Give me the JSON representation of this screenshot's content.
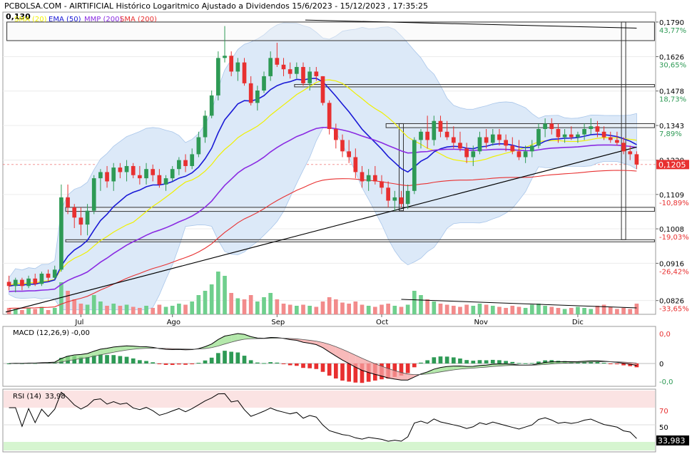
{
  "header": {
    "title": "PCBOLSA.COM - AIRTIFICIAL Histórico Logaritmico Ajustado a Dividendos 15/6/2023 - 15/12/2023 , 17:35:25",
    "price_marker": "0,130",
    "legend": [
      {
        "label": "SMA (20)",
        "color": "#f0f000"
      },
      {
        "label": "EMA (50)",
        "color": "#1a1ad6"
      },
      {
        "label": "MMP (200)",
        "color": "#8a2be2"
      },
      {
        "label": "SMA (200)",
        "color": "#e83030"
      }
    ]
  },
  "price_axis": {
    "ticks": [
      {
        "price": 0.179,
        "label": "0,1790",
        "pct": "43,77%"
      },
      {
        "price": 0.1626,
        "label": "0,1626",
        "pct": "30,65%"
      },
      {
        "price": 0.1478,
        "label": "0,1478",
        "pct": "18,73%"
      },
      {
        "price": 0.1343,
        "label": "0,1343",
        "pct": "7,89%"
      },
      {
        "price": 0.122,
        "label": "0,1220",
        "pct": ""
      },
      {
        "price": 0.1109,
        "label": "0,1109",
        "pct": "-10,89%"
      },
      {
        "price": 0.1008,
        "label": "0,1008",
        "pct": "-19,03%"
      },
      {
        "price": 0.0916,
        "label": "0,0916",
        "pct": "-26,42%"
      },
      {
        "price": 0.0826,
        "label": "0,0826",
        "pct": "-33,65%"
      }
    ],
    "current": {
      "price": 0.1205,
      "label": "0,1205"
    }
  },
  "months": [
    "Jul",
    "Ago",
    "Sep",
    "Oct",
    "Nov",
    "Dic"
  ],
  "macd": {
    "label": "MACD (12,26,9)",
    "value": "-0,00",
    "axis": [
      "0,0",
      "0",
      "-0,0"
    ]
  },
  "rsi": {
    "label": "RSI (14)",
    "value": "33,98",
    "current": "33,983",
    "axis": [
      "70",
      "50"
    ]
  },
  "colors": {
    "up": "#2e9a55",
    "down": "#e83030",
    "sma20": "#f0f000",
    "ema50": "#1a1ad6",
    "mmp200": "#8a2be2",
    "sma200": "#e83030",
    "band": "#dce9f8",
    "overbought": "#fbe3e3",
    "oversold": "#d6f5d0"
  },
  "chart_data": {
    "type": "candlestick",
    "title": "AIRTIFICIAL Histórico Logaritmico Ajustado a Dividendos 15/6/2023 - 15/12/2023",
    "y_scale": "log",
    "ylim": [
      0.0795,
      0.184
    ],
    "x_range": [
      "15/6/2023",
      "15/12/2023"
    ],
    "candles": [
      {
        "o": 0.087,
        "h": 0.0885,
        "l": 0.085,
        "c": 0.086
      },
      {
        "o": 0.086,
        "h": 0.088,
        "l": 0.0845,
        "c": 0.0875
      },
      {
        "o": 0.0875,
        "h": 0.088,
        "l": 0.085,
        "c": 0.086
      },
      {
        "o": 0.086,
        "h": 0.0885,
        "l": 0.0855,
        "c": 0.0878
      },
      {
        "o": 0.0878,
        "h": 0.089,
        "l": 0.086,
        "c": 0.0865
      },
      {
        "o": 0.0865,
        "h": 0.0895,
        "l": 0.086,
        "c": 0.089
      },
      {
        "o": 0.089,
        "h": 0.09,
        "l": 0.087,
        "c": 0.088
      },
      {
        "o": 0.088,
        "h": 0.091,
        "l": 0.0875,
        "c": 0.09
      },
      {
        "o": 0.09,
        "h": 0.114,
        "l": 0.0895,
        "c": 0.11
      },
      {
        "o": 0.11,
        "h": 0.114,
        "l": 0.105,
        "c": 0.107
      },
      {
        "o": 0.107,
        "h": 0.108,
        "l": 0.101,
        "c": 0.104
      },
      {
        "o": 0.104,
        "h": 0.107,
        "l": 0.099,
        "c": 0.102
      },
      {
        "o": 0.102,
        "h": 0.108,
        "l": 0.099,
        "c": 0.106
      },
      {
        "o": 0.106,
        "h": 0.117,
        "l": 0.105,
        "c": 0.116
      },
      {
        "o": 0.116,
        "h": 0.119,
        "l": 0.112,
        "c": 0.118
      },
      {
        "o": 0.118,
        "h": 0.12,
        "l": 0.113,
        "c": 0.115
      },
      {
        "o": 0.115,
        "h": 0.121,
        "l": 0.112,
        "c": 0.1195
      },
      {
        "o": 0.1195,
        "h": 0.121,
        "l": 0.116,
        "c": 0.118
      },
      {
        "o": 0.118,
        "h": 0.122,
        "l": 0.115,
        "c": 0.12
      },
      {
        "o": 0.12,
        "h": 0.121,
        "l": 0.116,
        "c": 0.117
      },
      {
        "o": 0.117,
        "h": 0.12,
        "l": 0.114,
        "c": 0.116
      },
      {
        "o": 0.116,
        "h": 0.121,
        "l": 0.114,
        "c": 0.119
      },
      {
        "o": 0.119,
        "h": 0.1205,
        "l": 0.115,
        "c": 0.117
      },
      {
        "o": 0.117,
        "h": 0.119,
        "l": 0.113,
        "c": 0.114
      },
      {
        "o": 0.114,
        "h": 0.117,
        "l": 0.112,
        "c": 0.116
      },
      {
        "o": 0.116,
        "h": 0.12,
        "l": 0.115,
        "c": 0.119
      },
      {
        "o": 0.119,
        "h": 0.123,
        "l": 0.117,
        "c": 0.122
      },
      {
        "o": 0.122,
        "h": 0.124,
        "l": 0.118,
        "c": 0.12
      },
      {
        "o": 0.12,
        "h": 0.126,
        "l": 0.119,
        "c": 0.124
      },
      {
        "o": 0.124,
        "h": 0.132,
        "l": 0.123,
        "c": 0.13
      },
      {
        "o": 0.13,
        "h": 0.14,
        "l": 0.128,
        "c": 0.138
      },
      {
        "o": 0.138,
        "h": 0.148,
        "l": 0.137,
        "c": 0.146
      },
      {
        "o": 0.146,
        "h": 0.165,
        "l": 0.144,
        "c": 0.162
      },
      {
        "o": 0.162,
        "h": 0.177,
        "l": 0.16,
        "c": 0.163
      },
      {
        "o": 0.163,
        "h": 0.165,
        "l": 0.154,
        "c": 0.156
      },
      {
        "o": 0.156,
        "h": 0.162,
        "l": 0.152,
        "c": 0.16
      },
      {
        "o": 0.16,
        "h": 0.162,
        "l": 0.15,
        "c": 0.151
      },
      {
        "o": 0.151,
        "h": 0.154,
        "l": 0.142,
        "c": 0.143
      },
      {
        "o": 0.143,
        "h": 0.15,
        "l": 0.14,
        "c": 0.148
      },
      {
        "o": 0.148,
        "h": 0.156,
        "l": 0.147,
        "c": 0.154
      },
      {
        "o": 0.154,
        "h": 0.165,
        "l": 0.152,
        "c": 0.162
      },
      {
        "o": 0.162,
        "h": 0.169,
        "l": 0.158,
        "c": 0.159
      },
      {
        "o": 0.159,
        "h": 0.162,
        "l": 0.154,
        "c": 0.157
      },
      {
        "o": 0.157,
        "h": 0.16,
        "l": 0.153,
        "c": 0.155
      },
      {
        "o": 0.155,
        "h": 0.16,
        "l": 0.153,
        "c": 0.158
      },
      {
        "o": 0.158,
        "h": 0.16,
        "l": 0.15,
        "c": 0.151
      },
      {
        "o": 0.151,
        "h": 0.158,
        "l": 0.148,
        "c": 0.156
      },
      {
        "o": 0.156,
        "h": 0.158,
        "l": 0.152,
        "c": 0.154
      },
      {
        "o": 0.154,
        "h": 0.152,
        "l": 0.142,
        "c": 0.143
      },
      {
        "o": 0.143,
        "h": 0.144,
        "l": 0.131,
        "c": 0.133
      },
      {
        "o": 0.133,
        "h": 0.135,
        "l": 0.126,
        "c": 0.129
      },
      {
        "o": 0.129,
        "h": 0.131,
        "l": 0.123,
        "c": 0.125
      },
      {
        "o": 0.125,
        "h": 0.129,
        "l": 0.121,
        "c": 0.123
      },
      {
        "o": 0.123,
        "h": 0.126,
        "l": 0.116,
        "c": 0.118
      },
      {
        "o": 0.118,
        "h": 0.12,
        "l": 0.113,
        "c": 0.115
      },
      {
        "o": 0.115,
        "h": 0.119,
        "l": 0.112,
        "c": 0.117
      },
      {
        "o": 0.117,
        "h": 0.12,
        "l": 0.114,
        "c": 0.115
      },
      {
        "o": 0.115,
        "h": 0.117,
        "l": 0.111,
        "c": 0.113
      },
      {
        "o": 0.113,
        "h": 0.115,
        "l": 0.107,
        "c": 0.109
      },
      {
        "o": 0.109,
        "h": 0.112,
        "l": 0.106,
        "c": 0.11
      },
      {
        "o": 0.11,
        "h": 0.112,
        "l": 0.107,
        "c": 0.108
      },
      {
        "o": 0.108,
        "h": 0.114,
        "l": 0.1065,
        "c": 0.112
      },
      {
        "o": 0.112,
        "h": 0.13,
        "l": 0.111,
        "c": 0.129
      },
      {
        "o": 0.129,
        "h": 0.133,
        "l": 0.126,
        "c": 0.132
      },
      {
        "o": 0.132,
        "h": 0.138,
        "l": 0.126,
        "c": 0.129
      },
      {
        "o": 0.129,
        "h": 0.138,
        "l": 0.127,
        "c": 0.136
      },
      {
        "o": 0.136,
        "h": 0.138,
        "l": 0.13,
        "c": 0.132
      },
      {
        "o": 0.132,
        "h": 0.136,
        "l": 0.129,
        "c": 0.13
      },
      {
        "o": 0.13,
        "h": 0.134,
        "l": 0.126,
        "c": 0.128
      },
      {
        "o": 0.128,
        "h": 0.132,
        "l": 0.125,
        "c": 0.126
      },
      {
        "o": 0.126,
        "h": 0.128,
        "l": 0.121,
        "c": 0.123
      },
      {
        "o": 0.123,
        "h": 0.127,
        "l": 0.12,
        "c": 0.125
      },
      {
        "o": 0.125,
        "h": 0.132,
        "l": 0.124,
        "c": 0.13
      },
      {
        "o": 0.13,
        "h": 0.133,
        "l": 0.126,
        "c": 0.128
      },
      {
        "o": 0.128,
        "h": 0.133,
        "l": 0.127,
        "c": 0.131
      },
      {
        "o": 0.131,
        "h": 0.133,
        "l": 0.127,
        "c": 0.129
      },
      {
        "o": 0.129,
        "h": 0.131,
        "l": 0.125,
        "c": 0.127
      },
      {
        "o": 0.127,
        "h": 0.13,
        "l": 0.124,
        "c": 0.125
      },
      {
        "o": 0.125,
        "h": 0.129,
        "l": 0.122,
        "c": 0.123
      },
      {
        "o": 0.123,
        "h": 0.127,
        "l": 0.121,
        "c": 0.125
      },
      {
        "o": 0.125,
        "h": 0.129,
        "l": 0.123,
        "c": 0.127
      },
      {
        "o": 0.127,
        "h": 0.135,
        "l": 0.126,
        "c": 0.133
      },
      {
        "o": 0.133,
        "h": 0.137,
        "l": 0.13,
        "c": 0.135
      },
      {
        "o": 0.135,
        "h": 0.137,
        "l": 0.131,
        "c": 0.133
      },
      {
        "o": 0.133,
        "h": 0.135,
        "l": 0.128,
        "c": 0.13
      },
      {
        "o": 0.13,
        "h": 0.133,
        "l": 0.128,
        "c": 0.131
      },
      {
        "o": 0.131,
        "h": 0.134,
        "l": 0.129,
        "c": 0.13
      },
      {
        "o": 0.13,
        "h": 0.132,
        "l": 0.128,
        "c": 0.131
      },
      {
        "o": 0.131,
        "h": 0.135,
        "l": 0.129,
        "c": 0.133
      },
      {
        "o": 0.133,
        "h": 0.137,
        "l": 0.131,
        "c": 0.134
      },
      {
        "o": 0.134,
        "h": 0.136,
        "l": 0.13,
        "c": 0.132
      },
      {
        "o": 0.132,
        "h": 0.134,
        "l": 0.129,
        "c": 0.13
      },
      {
        "o": 0.13,
        "h": 0.132,
        "l": 0.128,
        "c": 0.129
      },
      {
        "o": 0.129,
        "h": 0.132,
        "l": 0.127,
        "c": 0.128
      },
      {
        "o": 0.128,
        "h": 0.13,
        "l": 0.124,
        "c": 0.125
      },
      {
        "o": 0.125,
        "h": 0.127,
        "l": 0.122,
        "c": 0.124
      },
      {
        "o": 0.124,
        "h": 0.125,
        "l": 0.119,
        "c": 0.1205
      }
    ],
    "volume": [
      6,
      5,
      4,
      6,
      5,
      7,
      4,
      6,
      30,
      22,
      14,
      10,
      9,
      18,
      12,
      8,
      10,
      8,
      9,
      7,
      6,
      8,
      6,
      9,
      7,
      8,
      10,
      9,
      12,
      18,
      22,
      28,
      40,
      36,
      20,
      15,
      14,
      18,
      12,
      16,
      20,
      14,
      10,
      9,
      8,
      9,
      8,
      7,
      12,
      16,
      14,
      11,
      10,
      12,
      9,
      8,
      7,
      9,
      10,
      8,
      7,
      9,
      22,
      18,
      14,
      12,
      10,
      9,
      8,
      7,
      9,
      8,
      10,
      9,
      8,
      7,
      6,
      8,
      7,
      6,
      9,
      10,
      8,
      7,
      6,
      5,
      6,
      7,
      6,
      5,
      8,
      9,
      7,
      5,
      6,
      5,
      10
    ],
    "indicators": [
      {
        "name": "SMA (20)"
      },
      {
        "name": "EMA (50)"
      },
      {
        "name": "MMP (200)"
      },
      {
        "name": "SMA (200)"
      },
      {
        "name": "MACD (12,26,9)"
      },
      {
        "name": "RSI (14)",
        "last": 33.98
      }
    ],
    "rsi_levels": [
      70,
      50
    ]
  }
}
